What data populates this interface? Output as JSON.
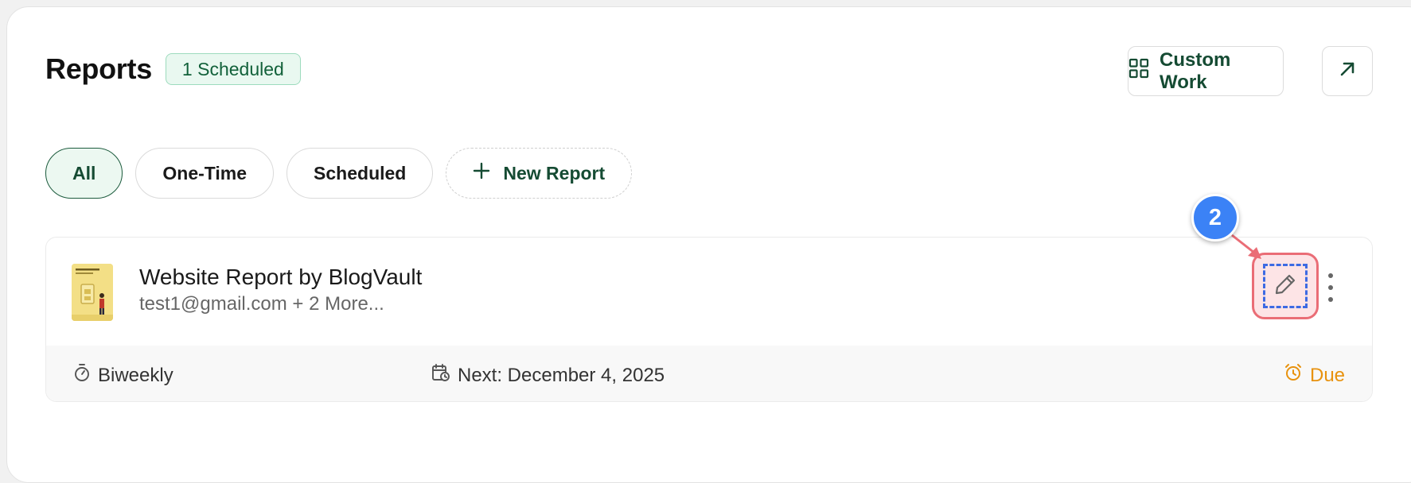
{
  "header": {
    "title": "Reports",
    "badge": "1 Scheduled"
  },
  "actions": {
    "custom_work_label": "Custom Work",
    "custom_work_icon": "grid-icon",
    "open_icon": "arrow-up-right-icon"
  },
  "filters": {
    "tabs": [
      {
        "label": "All",
        "active": true
      },
      {
        "label": "One-Time",
        "active": false
      },
      {
        "label": "Scheduled",
        "active": false
      }
    ],
    "new_report_label": "New Report"
  },
  "report": {
    "name": "Website Report by BlogVault",
    "recipients": "test1@gmail.com + 2 More...",
    "frequency": "Biweekly",
    "next_run": "Next: December 4, 2025",
    "status": "Due"
  },
  "annotation": {
    "marker_number": "2"
  },
  "colors": {
    "accent": "#154b33",
    "badge_bg": "#e9f8f0",
    "due": "#e8920e",
    "marker": "#3b82f6",
    "highlight": "#ea6d76"
  }
}
